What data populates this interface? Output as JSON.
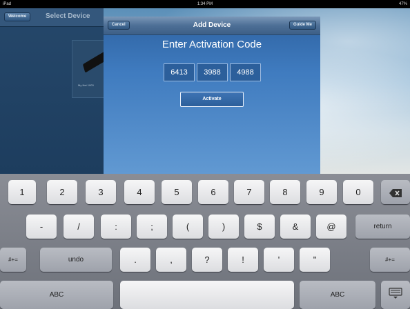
{
  "status": {
    "carrier": "iPad",
    "time": "1:34 PM",
    "battery": "47%"
  },
  "left_pane": {
    "back_button": "Welcome",
    "title": "Select Device",
    "device_name": "My Net 1003"
  },
  "modal": {
    "cancel": "Cancel",
    "title": "Add Device",
    "guide": "Guide Me",
    "heading": "Enter Activation Code",
    "code_fields": [
      "6413",
      "3988",
      "4988"
    ],
    "activate": "Activate"
  },
  "keyboard": {
    "row1": [
      "1",
      "2",
      "3",
      "4",
      "5",
      "6",
      "7",
      "8",
      "9",
      "0"
    ],
    "row2": [
      "-",
      "/",
      ":",
      ";",
      "(",
      ")",
      "$",
      "&",
      "@"
    ],
    "return": "return",
    "row3_left": "#+=",
    "undo": "undo",
    "row3": [
      ".",
      ",",
      "?",
      "!",
      "'",
      "\""
    ],
    "row3_right": "#+=",
    "abc_left": "ABC",
    "abc_right": "ABC"
  }
}
